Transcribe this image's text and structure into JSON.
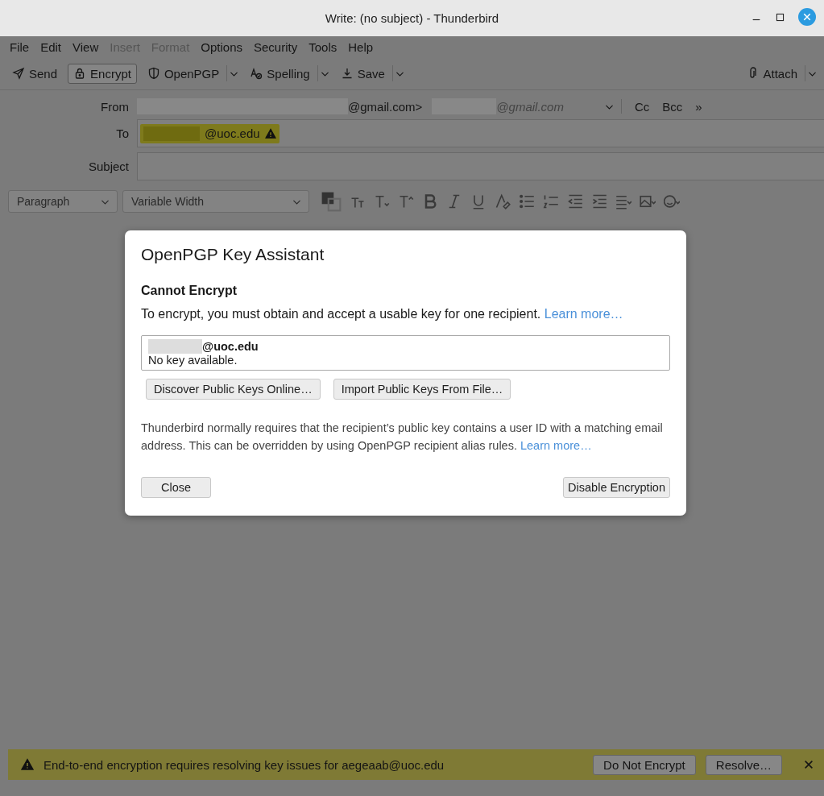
{
  "window": {
    "title": "Write: (no subject) - Thunderbird"
  },
  "menu": [
    {
      "label": "File",
      "disabled": false
    },
    {
      "label": "Edit",
      "disabled": false
    },
    {
      "label": "View",
      "disabled": false
    },
    {
      "label": "Insert",
      "disabled": true
    },
    {
      "label": "Format",
      "disabled": true
    },
    {
      "label": "Options",
      "disabled": false
    },
    {
      "label": "Security",
      "disabled": false
    },
    {
      "label": "Tools",
      "disabled": false
    },
    {
      "label": "Help",
      "disabled": false
    }
  ],
  "toolbar": [
    {
      "label": "Send",
      "pressed": false,
      "dropdown": false
    },
    {
      "label": "Encrypt",
      "pressed": true,
      "dropdown": false
    },
    {
      "label": "OpenPGP",
      "pressed": false,
      "dropdown": true
    },
    {
      "label": "Spelling",
      "pressed": false,
      "dropdown": true
    },
    {
      "label": "Save",
      "pressed": false,
      "dropdown": true
    },
    {
      "label": "Attach",
      "pressed": false,
      "dropdown": true
    }
  ],
  "header": {
    "from_label": "From",
    "from_value": "@gmail.com>",
    "from_identity": "@gmail.com",
    "cc": "Cc",
    "bcc": "Bcc",
    "more": "»",
    "to_label": "To",
    "recipients": [
      {
        "address": "@uoc.edu",
        "warning": true
      }
    ],
    "subject_label": "Subject"
  },
  "format_bar": {
    "paragraph": "Paragraph",
    "font": "Variable Width"
  },
  "dialog": {
    "title": "OpenPGP Key Assistant",
    "heading": "Cannot Encrypt",
    "text": "To encrypt, you must obtain and accept a usable key for one recipient.",
    "text_link": "Learn more…",
    "recipients": [
      {
        "address": "@uoc.edu",
        "status": "No key available."
      }
    ],
    "actions": [
      "Discover Public Keys Online…",
      "Import Public Keys From File…"
    ],
    "note": "Thunderbird normally requires that the recipient’s public key contains a user ID with a matching email address. This can be overridden by using OpenPGP recipient alias rules.",
    "note_link": "Learn more…",
    "close": "Close",
    "disable": "Disable Encryption"
  },
  "notification": {
    "message": "End-to-end encryption requires resolving key issues for aegeaab@uoc.edu",
    "buttons": [
      "Do Not Encrypt",
      "Resolve…"
    ]
  }
}
